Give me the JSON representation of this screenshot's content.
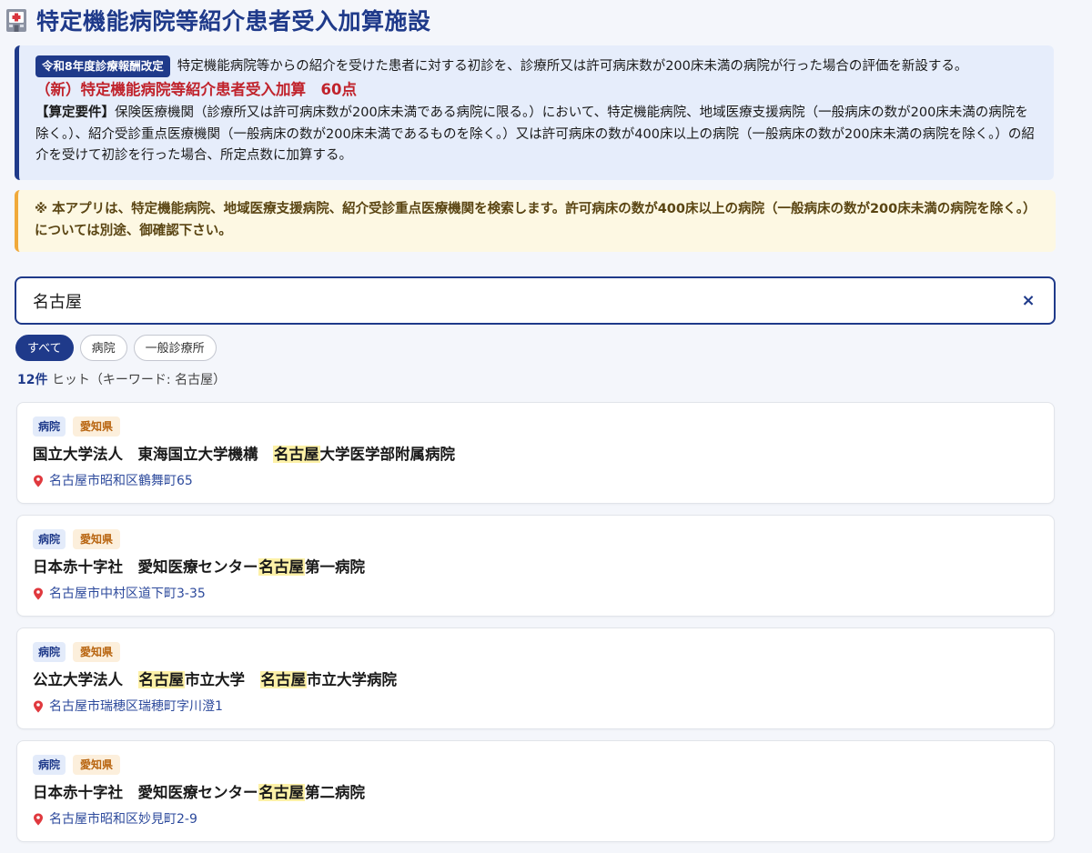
{
  "header": {
    "title": "特定機能病院等紹介患者受入加算施設",
    "icon": "hospital-icon"
  },
  "notice": {
    "badge": "令和8年度診療報酬改定",
    "summary": "特定機能病院等からの紹介を受けた患者に対する初診を、診療所又は許可病床数が200床未満の病院が行った場合の評価を新設する。",
    "addon_title": "（新）特定機能病院等紹介患者受入加算　60点",
    "requirement_label": "【算定要件】",
    "requirement_text": "保険医療機関（診療所又は許可病床数が200床未満である病院に限る。）において、特定機能病院、地域医療支援病院（一般病床の数が200床未満の病院を除く。）、紹介受診重点医療機関（一般病床の数が200床未満であるものを除く。）又は許可病床の数が400床以上の病院（一般病床の数が200床未満の病院を除く。）の紹介を受けて初診を行った場合、所定点数に加算する。"
  },
  "warning": {
    "text": "※ 本アプリは、特定機能病院、地域医療支援病院、紹介受診重点医療機関を検索します。許可病床の数が400床以上の病院（一般病床の数が200床未満の病院を除く。）については別途、御確認下さい。"
  },
  "search": {
    "value": "名古屋",
    "clear_label": "×"
  },
  "filters": [
    {
      "label": "すべて",
      "active": true
    },
    {
      "label": "病院",
      "active": false
    },
    {
      "label": "一般診療所",
      "active": false
    }
  ],
  "results": {
    "count": "12件",
    "summary": "ヒット（キーワード: 名古屋）",
    "items": [
      {
        "type": "病院",
        "prefecture": "愛知県",
        "name_parts": [
          "国立大学法人　東海国立大学機構　",
          "名古屋",
          "大学医学部附属病院"
        ],
        "address": "名古屋市昭和区鶴舞町65"
      },
      {
        "type": "病院",
        "prefecture": "愛知県",
        "name_parts": [
          "日本赤十字社　愛知医療センター",
          "名古屋",
          "第一病院"
        ],
        "address": "名古屋市中村区道下町3-35"
      },
      {
        "type": "病院",
        "prefecture": "愛知県",
        "name_parts": [
          "公立大学法人　",
          "名古屋",
          "市立大学　",
          "名古屋",
          "市立大学病院"
        ],
        "address": "名古屋市瑞穂区瑞穂町字川澄1"
      },
      {
        "type": "病院",
        "prefecture": "愛知県",
        "name_parts": [
          "日本赤十字社　愛知医療センター",
          "名古屋",
          "第二病院"
        ],
        "address": "名古屋市昭和区妙見町2-9"
      }
    ]
  },
  "colors": {
    "primary": "#1f3a8a",
    "accent_red": "#c0232c",
    "warning_border": "#f0a93a",
    "highlight": "#fdf1a7"
  }
}
